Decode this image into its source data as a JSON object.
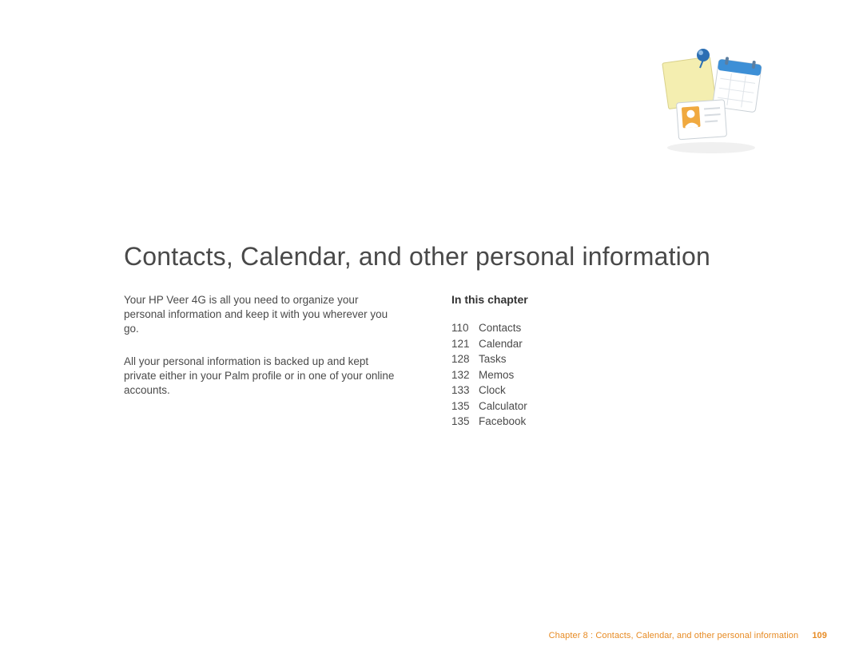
{
  "title": "Contacts, Calendar, and other personal information",
  "intro": {
    "p1": "Your HP Veer 4G is all you need to organize your personal information and keep it with you wherever you go.",
    "p2": "All your personal information is backed up and kept private either in your Palm profile or in one of your online accounts."
  },
  "toc": {
    "heading": "In this chapter",
    "items": [
      {
        "page": "110",
        "label": "Contacts"
      },
      {
        "page": "121",
        "label": "Calendar"
      },
      {
        "page": "128",
        "label": "Tasks"
      },
      {
        "page": "132",
        "label": "Memos"
      },
      {
        "page": "133",
        "label": "Clock"
      },
      {
        "page": "135",
        "label": "Calculator"
      },
      {
        "page": "135",
        "label": "Facebook"
      }
    ]
  },
  "footer": {
    "text": "Chapter 8  :  Contacts, Calendar, and other personal information",
    "page": "109"
  },
  "colors": {
    "accent": "#e78b24"
  }
}
